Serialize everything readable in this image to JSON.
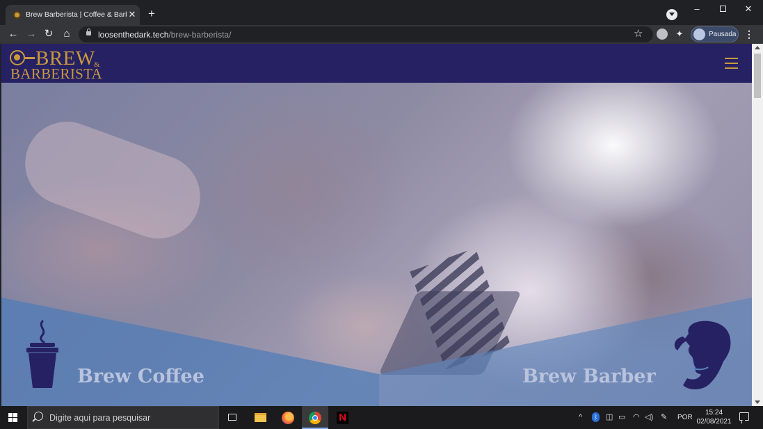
{
  "browser": {
    "tab": {
      "title": "Brew Barberista | Coffee & Barber",
      "favicon": "brew-barberista-favicon"
    },
    "new_tab_label": "+",
    "close_tab_label": "✕",
    "window": {
      "minimize": "–",
      "close": "✕"
    },
    "nav": {
      "back": "←",
      "forward": "→",
      "reload": "↻",
      "home": "⌂"
    },
    "url": {
      "domain": "loosenthedark.tech",
      "path": "/brew-barberista/"
    },
    "star": "☆",
    "extension_puzzle": "✦",
    "profile": {
      "label": "Pausada"
    },
    "menu": "⋮"
  },
  "site": {
    "logo": {
      "brew": "BREW",
      "amp": "&",
      "barberista": "BARBERISTA"
    },
    "panels": {
      "coffee_title": "Brew Coffee",
      "barber_title": "Brew Barber"
    },
    "colors": {
      "header_bg": "#262162",
      "accent_gold": "#c9993f",
      "panel_blue": "#5b85bd",
      "icon_navy": "#262162"
    }
  },
  "taskbar": {
    "search_placeholder": "Digite aqui para pesquisar",
    "tray": {
      "chevron": "^",
      "bluetooth": "ᛒ",
      "camera": "◫",
      "battery": "▭",
      "wifi": "◠",
      "volume": "◁)",
      "pen": "✎",
      "language": "POR"
    },
    "clock": {
      "time": "15:24",
      "date": "02/08/2021"
    }
  }
}
